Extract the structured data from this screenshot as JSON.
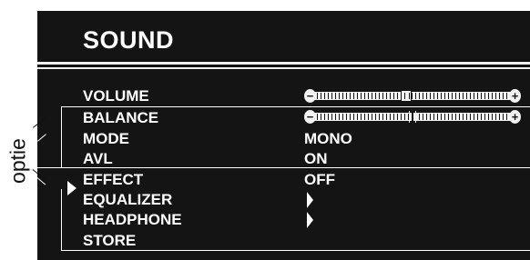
{
  "optie_label": "optie",
  "menu": {
    "title": "SOUND",
    "items": [
      {
        "label": "VOLUME",
        "kind": "slider",
        "slider_style": "knob",
        "level": 0.47
      },
      {
        "label": "BALANCE",
        "kind": "slider",
        "slider_style": "center",
        "level": 0.5
      },
      {
        "label": "MODE",
        "kind": "value",
        "value": "MONO"
      },
      {
        "label": "AVL",
        "kind": "value",
        "value": "ON"
      },
      {
        "label": "EFFECT",
        "kind": "value",
        "value": "OFF",
        "selected": true
      },
      {
        "label": "EQUALIZER",
        "kind": "submenu"
      },
      {
        "label": "HEADPHONE",
        "kind": "submenu"
      },
      {
        "label": "STORE",
        "kind": "action"
      }
    ]
  },
  "colors": {
    "background": "#141414",
    "foreground": "#f2f2f2",
    "page": "#ffffff"
  }
}
